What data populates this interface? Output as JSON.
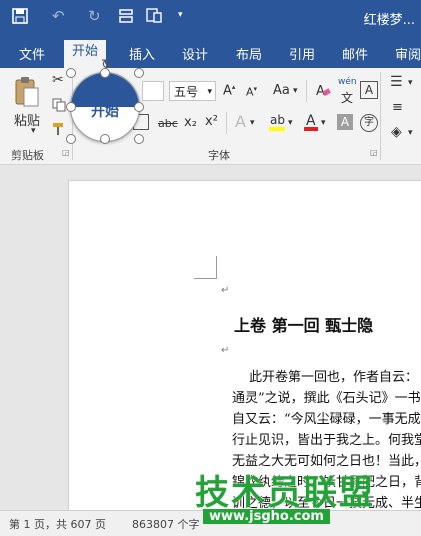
{
  "window": {
    "title": "红楼梦..."
  },
  "quick_access": {
    "save_icon": "save-icon",
    "undo_icon": "undo-icon",
    "redo_icon": "redo-icon",
    "touch_icon": "touch-mode-icon",
    "format_icon": "format-painter-icon",
    "customize_icon": "customize-qat-icon"
  },
  "tabs": [
    {
      "label": "文件"
    },
    {
      "label": "开始"
    },
    {
      "label": "插入"
    },
    {
      "label": "设计"
    },
    {
      "label": "布局"
    },
    {
      "label": "引用"
    },
    {
      "label": "邮件"
    },
    {
      "label": "审阅"
    }
  ],
  "ribbon": {
    "clipboard": {
      "paste_label": "粘贴",
      "group_label": "剪贴板"
    },
    "font": {
      "size_value": "五号",
      "case_label": "Aa",
      "wen_label": "wén",
      "group_label": "字体",
      "strike_label": "abc",
      "sub_label": "x₂",
      "sup_label": "x²"
    }
  },
  "zoom_callout": {
    "label": "开始"
  },
  "document": {
    "heading": "上卷  第一回    甄士隐",
    "lines": [
      "此开卷第一回也，作者自云：",
      "通灵”之说，撰此《石头记》一书",
      "自又云：“今风尘碌碌，一事无成",
      "行止见识，皆出于我之上。何我堂",
      "无益之大无可如何之日也！当此，",
      "锦衣纨绔之时，饫甘餍肥之日，背父兄教育之恩，",
      "训之德，以至今日一技无成、半生潦倒之罪，编述一集，以告天下人："
    ]
  },
  "status": {
    "page_info": "第 1 页，共 607 页",
    "word_count": "863807 个字"
  },
  "watermark": {
    "text": "技术员联盟",
    "url": "www.jsgho.com"
  }
}
